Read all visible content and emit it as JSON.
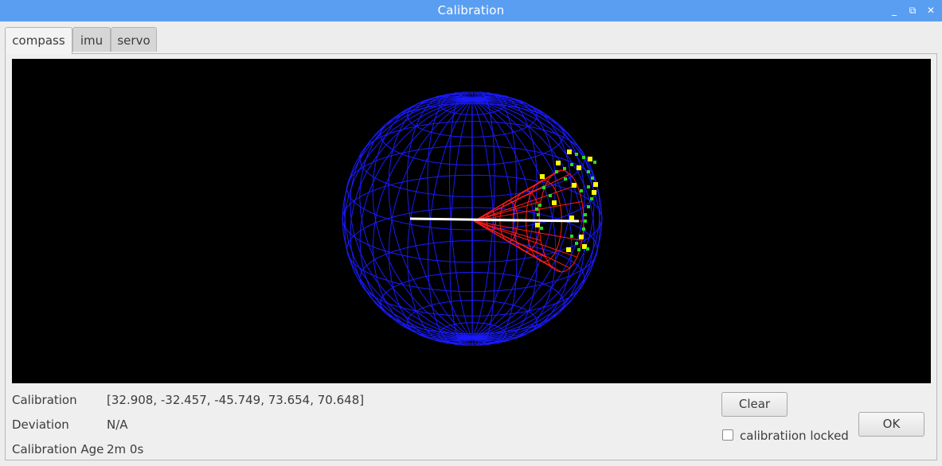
{
  "window": {
    "title": "Calibration",
    "minimize_glyph": "_",
    "restore_glyph": "⧉",
    "close_glyph": "✕"
  },
  "tabs": [
    {
      "label": "compass",
      "active": true
    },
    {
      "label": "imu",
      "active": false
    },
    {
      "label": "servo",
      "active": false
    }
  ],
  "view": {
    "background": "#000000",
    "sphere_color": "#1a1aff",
    "cone_color": "#ff1a1a",
    "axis_color": "#ffffff",
    "point_colors": [
      "#ffff00",
      "#22dd22"
    ]
  },
  "info": {
    "calibration_label": "Calibration",
    "calibration_value": "[32.908, -32.457, -45.749, 73.654, 70.648]",
    "deviation_label": "Deviation",
    "deviation_value": "N/A",
    "age_label": "Calibration Age",
    "age_value": "2m 0s"
  },
  "controls": {
    "clear_label": "Clear",
    "locked_label": "calibratiion locked",
    "locked_checked": false,
    "ok_label": "OK"
  }
}
